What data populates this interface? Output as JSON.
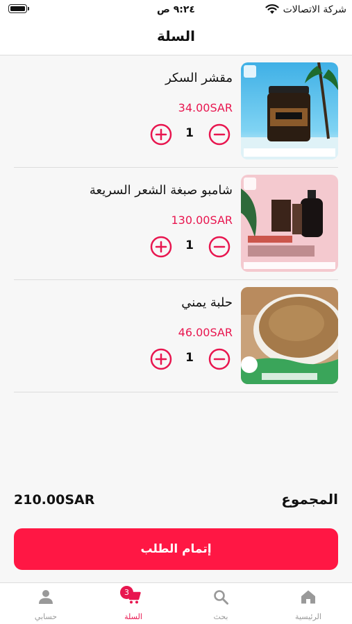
{
  "status_bar": {
    "time": "٩:٢٤ ص",
    "carrier": "شركة الاتصالات",
    "wifi_icon": "wifi-icon",
    "battery_icon": "battery-icon"
  },
  "header": {
    "title": "السلة"
  },
  "cart": {
    "items": [
      {
        "name": "مقشر السكر",
        "price": "34.00SAR",
        "quantity": "1",
        "image_icon": "product-image-sugar-scrub"
      },
      {
        "name": "شامبو صبغة الشعر السريعة",
        "price": "130.00SAR",
        "quantity": "1",
        "image_icon": "product-image-argan-shampoo"
      },
      {
        "name": "حلبة يمني",
        "price": "46.00SAR",
        "quantity": "1",
        "image_icon": "product-image-fenugreek"
      }
    ]
  },
  "summary": {
    "total_label": "المجموع",
    "total_value": "210.00SAR"
  },
  "checkout": {
    "label": "إتمام الطلب"
  },
  "tab_bar": {
    "tabs": [
      {
        "label": "الرئيسية",
        "icon": "home-icon"
      },
      {
        "label": "بحث",
        "icon": "search-icon"
      },
      {
        "label": "السلة",
        "icon": "cart-icon",
        "badge": "3",
        "active": true
      },
      {
        "label": "حسابي",
        "icon": "person-icon"
      }
    ]
  },
  "colors": {
    "accent": "#e8164f",
    "checkout_button": "#ff1744",
    "inactive_tab": "#999999"
  }
}
